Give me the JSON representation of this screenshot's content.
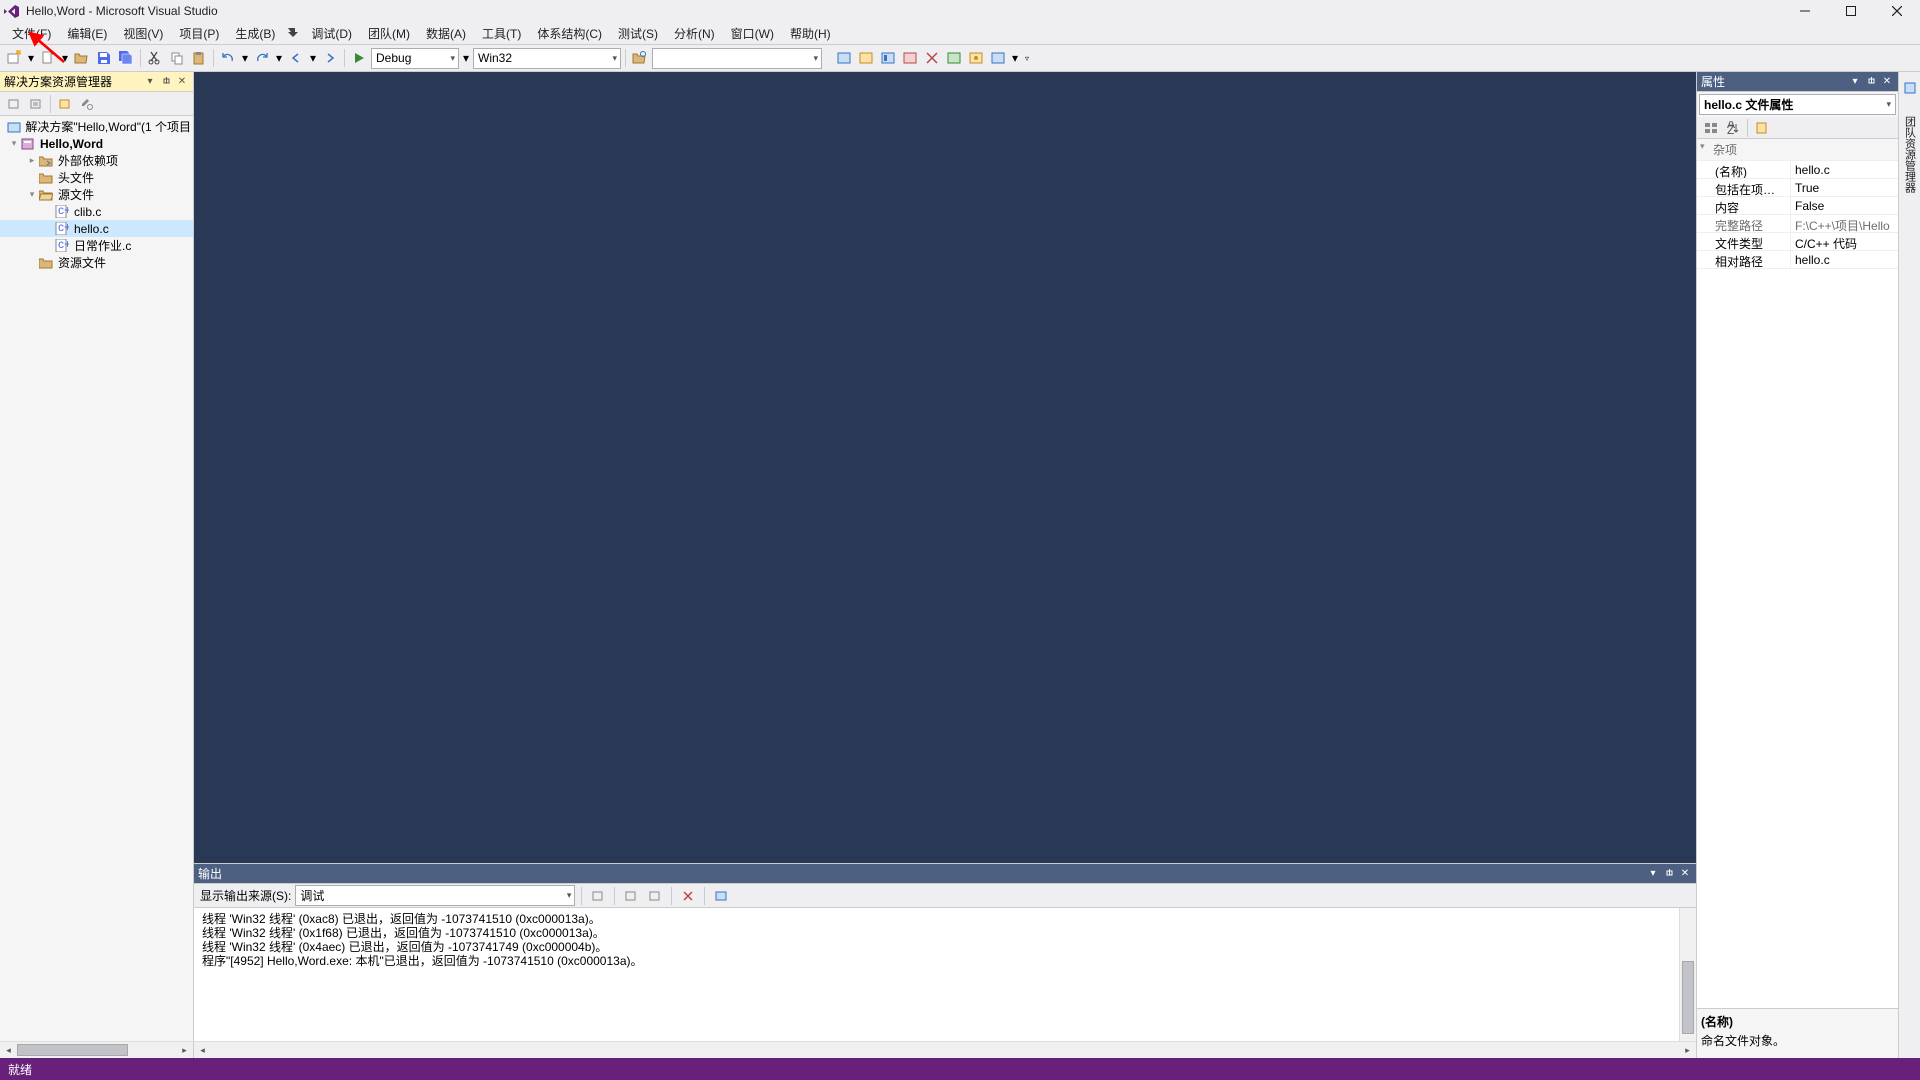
{
  "title": "Hello,Word - Microsoft Visual Studio",
  "menu": [
    "文件(F)",
    "编辑(E)",
    "视图(V)",
    "项目(P)",
    "生成(B)",
    "调试(D)",
    "团队(M)",
    "数据(A)",
    "工具(T)",
    "体系结构(C)",
    "测试(S)",
    "分析(N)",
    "窗口(W)",
    "帮助(H)"
  ],
  "toolbar": {
    "config": "Debug",
    "platform": "Win32",
    "search": ""
  },
  "solution_explorer": {
    "title": "解决方案资源管理器",
    "root": "解决方案\"Hello,Word\"(1 个项目",
    "project": "Hello,Word",
    "folders": {
      "ext": "外部依赖项",
      "headers": "头文件",
      "sources": "源文件",
      "resources": "资源文件"
    },
    "files": [
      "clib.c",
      "hello.c",
      "日常作业.c"
    ],
    "selected": "hello.c"
  },
  "properties": {
    "title": "属性",
    "object": "hello.c 文件属性",
    "cat": "杂项",
    "rows": [
      {
        "n": "(名称)",
        "v": "hello.c",
        "dis": false
      },
      {
        "n": "包括在项目中",
        "v": "True",
        "dis": false
      },
      {
        "n": "内容",
        "v": "False",
        "dis": false
      },
      {
        "n": "完整路径",
        "v": "F:\\C++\\项目\\Hello",
        "dis": true
      },
      {
        "n": "文件类型",
        "v": "C/C++ 代码",
        "dis": false
      },
      {
        "n": "相对路径",
        "v": "hello.c",
        "dis": false
      }
    ],
    "desc_title": "(名称)",
    "desc_body": "命名文件对象。"
  },
  "rightTabs": [
    "团队资源管理器"
  ],
  "output": {
    "title": "输出",
    "src_label": "显示输出来源(S):",
    "src_value": "调试",
    "lines": [
      "线程 'Win32 线程' (0xac8) 已退出，返回值为 -1073741510 (0xc000013a)。",
      "线程 'Win32 线程' (0x1f68) 已退出，返回值为 -1073741510 (0xc000013a)。",
      "线程 'Win32 线程' (0x4aec) 已退出，返回值为 -1073741749 (0xc000004b)。",
      "程序\"[4952] Hello,Word.exe: 本机\"已退出，返回值为 -1073741510 (0xc000013a)。"
    ]
  },
  "status": "就绪"
}
